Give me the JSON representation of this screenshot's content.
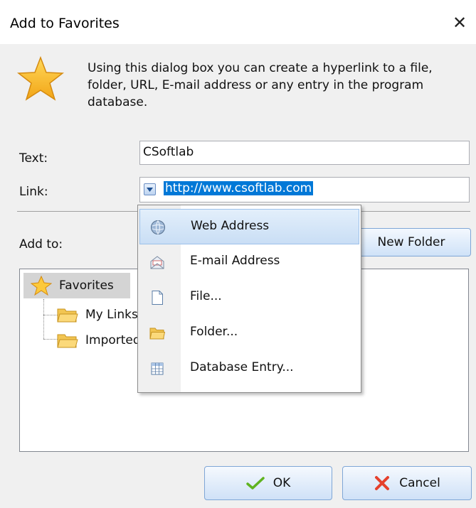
{
  "window": {
    "title": "Add to Favorites",
    "close_glyph": "✕"
  },
  "info": {
    "text": "Using this dialog box  you can create a hyperlink to a file, folder, URL, E-mail address or any entry in the program database."
  },
  "form": {
    "text_label": "Text:",
    "text_value": "CSoftlab",
    "link_label": "Link:",
    "link_value": "http://www.csoftlab.com"
  },
  "add_to": {
    "label": "Add to:",
    "new_folder_label": "New Folder"
  },
  "tree": {
    "root": {
      "label": "Favorites",
      "icon": "star-icon"
    },
    "children": [
      {
        "label": "My Links",
        "icon": "folder-icon"
      },
      {
        "label": "Imported",
        "icon": "folder-icon"
      }
    ]
  },
  "link_menu": {
    "items": [
      {
        "label": "Web Address",
        "icon": "globe-icon",
        "highlighted": true
      },
      {
        "label": "E-mail Address",
        "icon": "envelope-icon",
        "highlighted": false
      },
      {
        "label": "File...",
        "icon": "file-icon",
        "highlighted": false
      },
      {
        "label": "Folder...",
        "icon": "folder-icon",
        "highlighted": false
      },
      {
        "label": "Database Entry...",
        "icon": "table-icon",
        "highlighted": false
      }
    ]
  },
  "footer": {
    "ok_label": "OK",
    "cancel_label": "Cancel"
  },
  "colors": {
    "selection": "#0078d7",
    "button_border": "#7fa6d6",
    "star": "#f5b321"
  }
}
